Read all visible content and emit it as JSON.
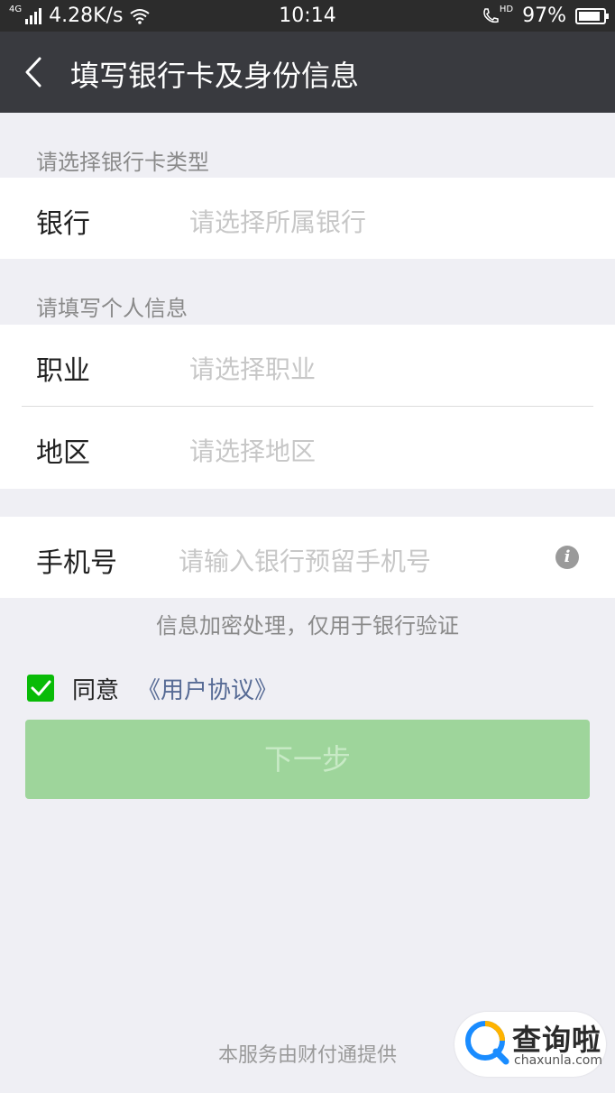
{
  "status": {
    "network_label": "4G",
    "speed": "4.28K/s",
    "time": "10:14",
    "hd_label": "HD",
    "battery": "97%",
    "battery_level": 0.97
  },
  "navbar": {
    "title": "填写银行卡及身份信息"
  },
  "bank_section": {
    "header": "请选择银行卡类型",
    "bank_label": "银行",
    "bank_placeholder": "请选择所属银行"
  },
  "personal_section": {
    "header": "请填写个人信息",
    "occupation_label": "职业",
    "occupation_placeholder": "请选择职业",
    "region_label": "地区",
    "region_placeholder": "请选择地区"
  },
  "phone": {
    "label": "手机号",
    "placeholder": "请输入银行预留手机号",
    "info_icon": "i"
  },
  "hint": "信息加密处理，仅用于银行验证",
  "agreement": {
    "checked": true,
    "text": "同意",
    "link": "《用户协议》"
  },
  "next_button": "下一步",
  "footer": "本服务由财付通提供",
  "watermark": {
    "name": "查询啦",
    "url": "chaxunla.com"
  },
  "colors": {
    "navbar": "#393a3f",
    "accent_green": "#09bb07",
    "button_disabled": "#9ed59b",
    "link": "#576b95"
  }
}
